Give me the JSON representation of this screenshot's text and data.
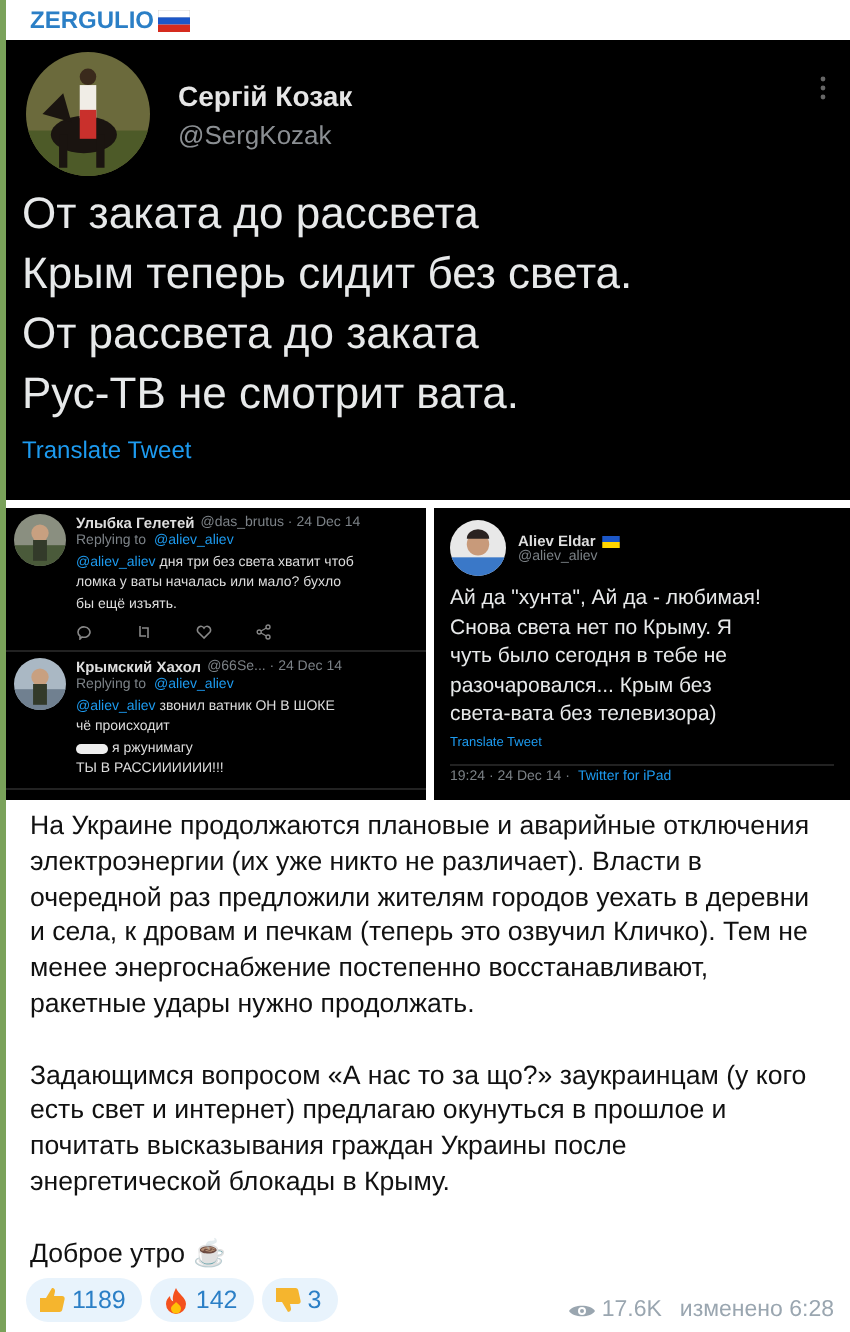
{
  "channel": {
    "name": "ZERGULIO"
  },
  "tweet": {
    "author": "Сергій Козак",
    "handle": "@SergKozak",
    "lines": [
      "От заката до рассвета",
      "Крым теперь сидит без света.",
      "От рассвета до заката",
      "Рус-ТВ не смотрит вата."
    ],
    "translate": "Translate Tweet"
  },
  "replies": [
    {
      "author": "Улыбка Гелетей",
      "meta": "@das_brutus · 24 Dec 14",
      "replying_label": "Replying to",
      "replying_to": "@aliev_aliev",
      "mention": "@aliev_aliev",
      "lines": [
        {
          "text": "дня три без света хватит чтоб",
          "redacted": false
        },
        {
          "text": "ломка у ваты началась или мало? бухло",
          "redacted": false
        },
        {
          "text": "бы ещё изъять.",
          "redacted": false
        }
      ],
      "actions": true
    },
    {
      "author": "Крымский Хахол",
      "meta": "@66Se... · 24 Dec 14",
      "replying_label": "Replying to",
      "replying_to": "@aliev_aliev",
      "mention": "@aliev_aliev",
      "lines": [
        {
          "text": "звонил ватник ОН В ШОКЕ",
          "redacted": false
        },
        {
          "text": "чё происходит",
          "redacted": false
        },
        {
          "text": "я ржунимагу",
          "redacted": true
        },
        {
          "text": "ТЫ В РАССИИИИИИ!!!",
          "redacted": false
        }
      ],
      "actions": false
    }
  ],
  "side_tweet": {
    "author": "Aliev Eldar",
    "handle": "@aliev_aliev",
    "lines": [
      "Ай да \"хунта\", Ай да - любимая!",
      "Снова света нет по Крыму. Я",
      "чуть было сегодня в тебе не",
      "разочаровался... Крым без",
      "света-вата без телевизора)"
    ],
    "translate": "Translate Tweet",
    "time": "19:24 · 24 Dec 14 ·",
    "source": "Twitter for iPad"
  },
  "post": {
    "paragraphs": [
      "На Украине продолжаются плановые и аварийные отключения электроэнергии (их уже никто не различает). Власти в очередной раз предложили жителям городов уехать в деревни и села, к дровам и печкам (теперь это озвучил Кличко). Тем не менее энергоснабжение постепенно восстанавливают, ракетные удары нужно продолжать.",
      "Задающимся вопросом «А нас то за що?» заукраинцам (у кого есть свет и интернет) предлагаю окунуться в прошлое и почитать высказывания граждан Украины после энергетической блокады в Крыму.",
      "Доброе утро ☕"
    ]
  },
  "reactions": [
    {
      "kind": "thumbs_up",
      "count": "1189"
    },
    {
      "kind": "fire",
      "count": "142"
    },
    {
      "kind": "thumbs_down",
      "count": "3"
    }
  ],
  "footer": {
    "views": "17.6K",
    "edited": "изменено 6:28"
  }
}
